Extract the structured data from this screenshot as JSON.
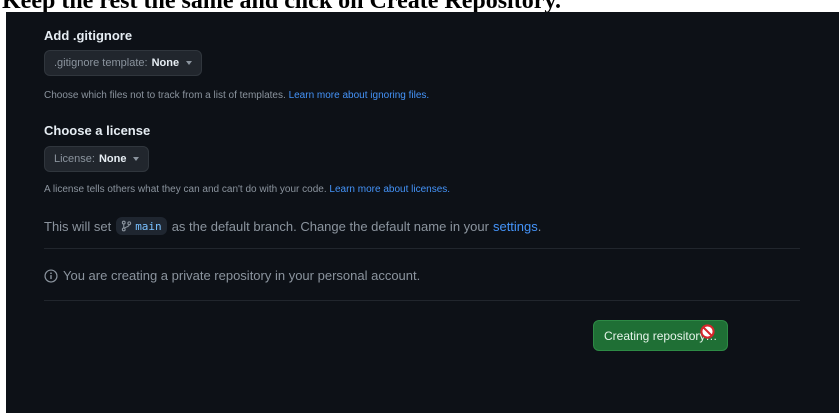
{
  "caption": "Keep the rest the same and click on Create Repository.",
  "gitignore": {
    "title": "Add .gitignore",
    "select_label": ".gitignore template:",
    "select_value": "None",
    "help_text": "Choose which files not to track from a list of templates.",
    "help_link": "Learn more about ignoring files."
  },
  "license": {
    "title": "Choose a license",
    "select_label": "License:",
    "select_value": "None",
    "help_text": "A license tells others what they can and can't do with your code.",
    "help_link": "Learn more about licenses."
  },
  "branch": {
    "prefix": "This will set",
    "branch_name": "main",
    "middle": "as the default branch. Change the default name in your",
    "settings_link": "settings",
    "suffix": "."
  },
  "info": {
    "text": "You are creating a private repository in your personal account."
  },
  "submit": {
    "label": "Creating repository…"
  },
  "colors": {
    "background": "#0d1117",
    "link": "#4493f8",
    "button": "#1f6f35"
  }
}
